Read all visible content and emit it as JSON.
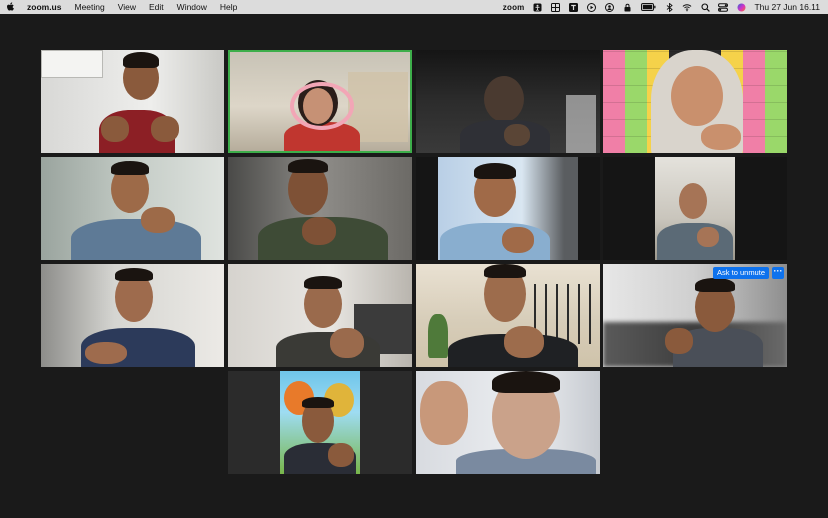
{
  "menubar": {
    "app_name": "zoom.us",
    "menus": [
      "Meeting",
      "View",
      "Edit",
      "Window",
      "Help"
    ],
    "status_app": "zoom",
    "clock": "Thu 27 Jun  16.11"
  },
  "tiles": {
    "ask_to_unmute_label": "Ask to unmute",
    "more_label": "···"
  },
  "colors": {
    "active_speaker_border": "#3dae4a",
    "unmute_button": "#0e72ed",
    "background": "#1a1a1a"
  }
}
